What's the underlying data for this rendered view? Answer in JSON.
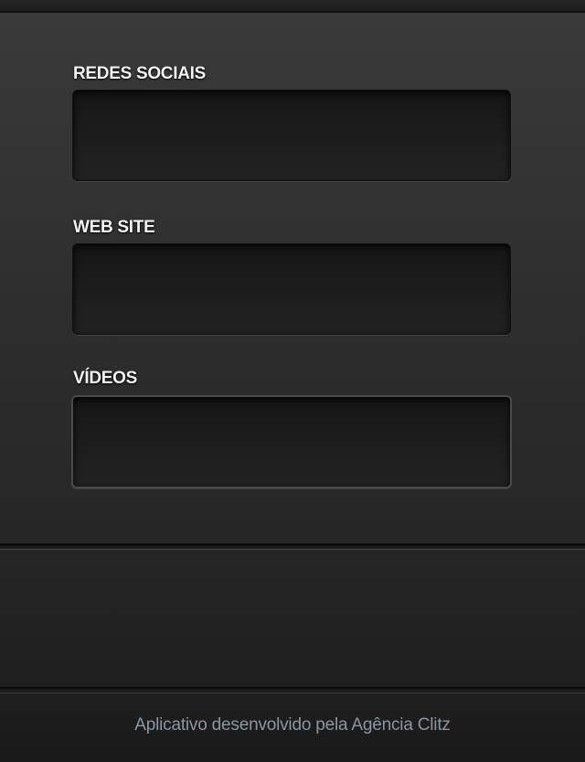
{
  "sections": [
    {
      "label": "REDES SOCIAIS",
      "value": ""
    },
    {
      "label": "WEB SITE",
      "value": ""
    },
    {
      "label": "VÍDEOS",
      "value": ""
    }
  ],
  "footer": {
    "text": "Aplicativo desenvolvido pela Agência Clitz"
  },
  "colors": {
    "label": "#f4f4f4",
    "footer_text": "#8a97a3",
    "background": "#2e2e2e"
  }
}
